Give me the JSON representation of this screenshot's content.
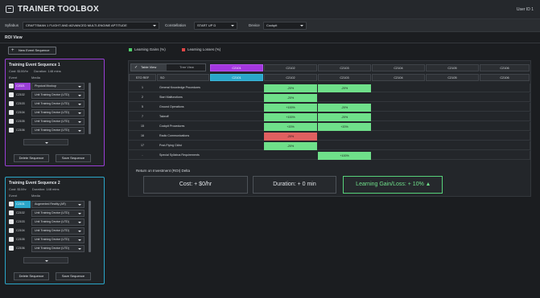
{
  "app": {
    "title": "TRAINER TOOLBOX",
    "user": "User ID 1"
  },
  "filters": {
    "syllabus_label": "Syllabus",
    "syllabus_value": "CRAFTSMAN 1 FLIGHT AND ADVANCED MULTI-ENGINE APTITUDE",
    "constellation_label": "Constellation",
    "constellation_value": "START UP D",
    "device_label": "Device",
    "device_value": "Cockpit"
  },
  "roi_view_label": "ROI View",
  "new_sequence_label": "New Event Sequence",
  "sequences": [
    {
      "title": "Training Event Sequence 1",
      "cost": "Cost: $100/hr",
      "duration": "Duration: 148 mins",
      "col_event": "Event",
      "col_media": "Media",
      "events": [
        {
          "code": "C2021",
          "media": "Physical Mockup"
        },
        {
          "code": "C2102",
          "media": "Unit Training Device (UTD)"
        },
        {
          "code": "C2103",
          "media": "Unit Training Device (UTD)"
        },
        {
          "code": "C2104",
          "media": "Unit Training Device (UTD)"
        },
        {
          "code": "C2105",
          "media": "Unit Training Device (UTD)"
        },
        {
          "code": "C2106",
          "media": "Unit Training Device (UTD)"
        }
      ],
      "delete_label": "Delete Sequence",
      "save_label": "Save Sequence"
    },
    {
      "title": "Training Event Sequence 2",
      "cost": "Cost: $10/hr",
      "duration": "Duration: 148 mins",
      "col_event": "Event",
      "col_media": "Media",
      "events": [
        {
          "code": "C2101",
          "media": "Augmented Reality (AR)"
        },
        {
          "code": "C2102",
          "media": "Unit Training Device (UTD)"
        },
        {
          "code": "C2103",
          "media": "Unit Training Device (UTD)"
        },
        {
          "code": "C2104",
          "media": "Unit Training Device (UTD)"
        },
        {
          "code": "C2105",
          "media": "Unit Training Device (UTD)"
        },
        {
          "code": "C2106",
          "media": "Unit Training Device (UTD)"
        }
      ],
      "delete_label": "Delete Sequence",
      "save_label": "Save Sequence"
    }
  ],
  "legend": {
    "gains": "Learning Gains (%)",
    "losses": "Learning Losses (%)",
    "gain_color": "#4fd06a",
    "loss_color": "#e04646"
  },
  "table": {
    "view_table": "Table View",
    "view_tree": "Tree View",
    "seq1_events": [
      "C2101",
      "C2102",
      "C2103",
      "C2104",
      "C2105",
      "C2106"
    ],
    "seq2_events": [
      "C2101",
      "C2102",
      "C2103",
      "C2104",
      "C2105",
      "C2106"
    ],
    "col_objective": "STO REF",
    "col_task": "SO",
    "rows": [
      {
        "num": "1",
        "name": "General Knowledge Procedures"
      },
      {
        "num": "2",
        "name": "Start Malfunctions"
      },
      {
        "num": "5",
        "name": "Ground Operations"
      },
      {
        "num": "7",
        "name": "Takeoff"
      },
      {
        "num": "15",
        "name": "Cockpit Procedures"
      },
      {
        "num": "16",
        "name": "Radio Communications"
      },
      {
        "num": "17",
        "name": "Post-Flying Cklist"
      },
      {
        "num": "-",
        "name": "Special Syllabus Requirements"
      }
    ],
    "values": {
      "r0c1": "-20%",
      "r0c2": "-20%",
      "r1c1": "-20%",
      "r2c1": "+100%",
      "r2c2": "-20%",
      "r3c1": "+100%",
      "r3c2": "-20%",
      "r4c1": "+20%",
      "r4c2": "+20%",
      "r5c1": "-20%",
      "r6c1": "-20%",
      "r7c2": "+100%"
    }
  },
  "roi": {
    "title": "Return on Investment (ROI) Delta",
    "cost": "Cost: + $0/hr",
    "duration": "Duration: + 0 min",
    "gain": "Learning Gain/Loss: + 10%"
  }
}
